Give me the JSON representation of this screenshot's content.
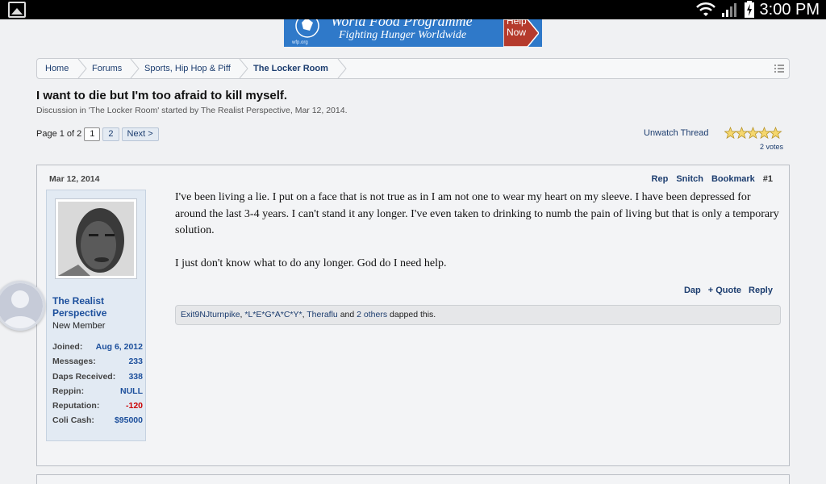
{
  "status_bar": {
    "time": "3:00 PM"
  },
  "banner": {
    "org_name": "World Food Programme",
    "tagline": "Fighting Hunger Worldwide",
    "site": "wfp.org",
    "help_line1": "Help",
    "help_line2": "Now"
  },
  "breadcrumb": {
    "items": [
      {
        "label": "Home"
      },
      {
        "label": "Forums"
      },
      {
        "label": "Sports, Hip Hop & Piff"
      },
      {
        "label": "The Locker Room"
      }
    ]
  },
  "thread": {
    "title": "I want to die but I'm too afraid to kill myself.",
    "meta": "Discussion in 'The Locker Room' started by The Realist Perspective, Mar 12, 2014."
  },
  "pager": {
    "label": "Page 1 of 2",
    "pages": [
      "1",
      "2"
    ],
    "next": "Next >"
  },
  "thread_tools": {
    "unwatch": "Unwatch Thread",
    "rating_stars": 5,
    "votes": "2 votes"
  },
  "post": {
    "date": "Mar 12, 2014",
    "actions": {
      "rep": "Rep",
      "snitch": "Snitch",
      "bookmark": "Bookmark",
      "number": "#1"
    },
    "user": {
      "name": "The Realist Perspective",
      "title": "New Member",
      "stats": [
        {
          "label": "Joined:",
          "value": "Aug 6, 2012"
        },
        {
          "label": "Messages:",
          "value": "233"
        },
        {
          "label": "Daps Received:",
          "value": "338"
        },
        {
          "label": "Reppin:",
          "value": "NULL"
        },
        {
          "label": "Reputation:",
          "value": "-120"
        },
        {
          "label": "Coli Cash:",
          "value": "$95000"
        }
      ]
    },
    "body": [
      "I've been living a lie. I put on a face that is not true as in I am not one to wear my heart on my sleeve. I have been depressed for around the last 3-4 years. I can't stand it any longer. I've even taken to drinking to numb the pain of living but that is only a temporary solution.",
      "I just don't know what to do any longer. God do I need help."
    ],
    "message_actions": {
      "dap": "Dap",
      "quote": "+ Quote",
      "reply": "Reply"
    },
    "dappers": {
      "users": [
        "Exit9NJturnpike",
        "*L*E*G*A*C*Y*",
        "Theraflu"
      ],
      "and": "and",
      "others": "2 others",
      "suffix": "dapped this."
    }
  }
}
